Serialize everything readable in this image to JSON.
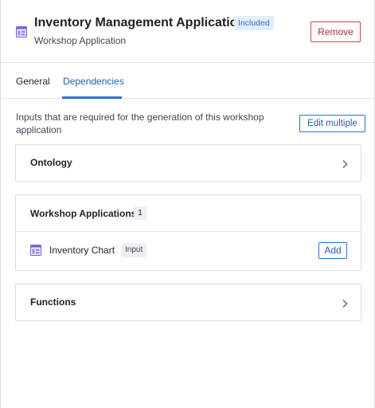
{
  "header": {
    "title": "Inventory Management Application",
    "badge": "Included",
    "subtitle": "Workshop Application",
    "remove_label": "Remove",
    "app_icon": "workshop-app-icon"
  },
  "tabs": [
    {
      "label": "General",
      "active": false
    },
    {
      "label": "Dependencies",
      "active": true
    }
  ],
  "dependencies": {
    "description": "Inputs that are required for the generation of this workshop application",
    "edit_multiple_label": "Edit multiple",
    "sections": {
      "ontology": {
        "title": "Ontology",
        "expanded": false
      },
      "workshop_applications": {
        "title": "Workshop Applications",
        "count": "1",
        "expanded": true,
        "items": [
          {
            "label": "Inventory Chart",
            "tag": "Input",
            "action_label": "Add",
            "icon": "workshop-app-icon"
          }
        ]
      },
      "functions": {
        "title": "Functions",
        "expanded": false
      }
    }
  },
  "colors": {
    "accent": "#2d72d2",
    "danger": "#cd4246",
    "app_icon": "#7961db"
  }
}
